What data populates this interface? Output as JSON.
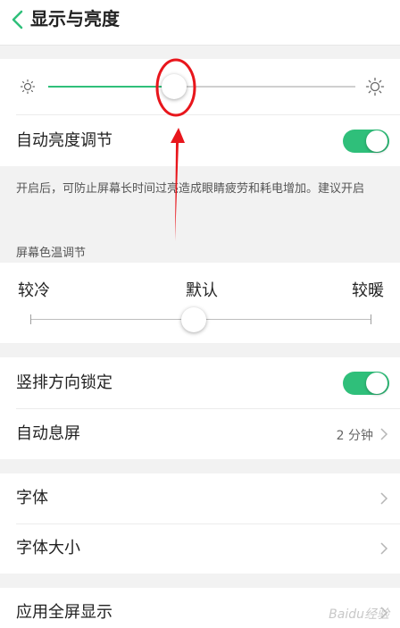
{
  "header": {
    "title": "显示与亮度"
  },
  "brightness": {
    "level": 0.41
  },
  "auto_brightness": {
    "label": "自动亮度调节",
    "enabled": true,
    "description": "开启后，可防止屏幕长时间过亮造成眼睛疲劳和耗电增加。建议开启"
  },
  "color_temp": {
    "section_title": "屏幕色温调节",
    "cool_label": "较冷",
    "default_label": "默认",
    "warm_label": "较暖",
    "level": 0.5
  },
  "portrait_lock": {
    "label": "竖排方向锁定",
    "enabled": true
  },
  "auto_lock": {
    "label": "自动息屏",
    "value": "2 分钟"
  },
  "font": {
    "label": "字体"
  },
  "font_size": {
    "label": "字体大小"
  },
  "full_screen": {
    "label": "应用全屏显示"
  },
  "watermark": {
    "text": "Baidu经验"
  },
  "colors": {
    "accent": "#2fbf7a",
    "annotation": "#e8161c"
  }
}
